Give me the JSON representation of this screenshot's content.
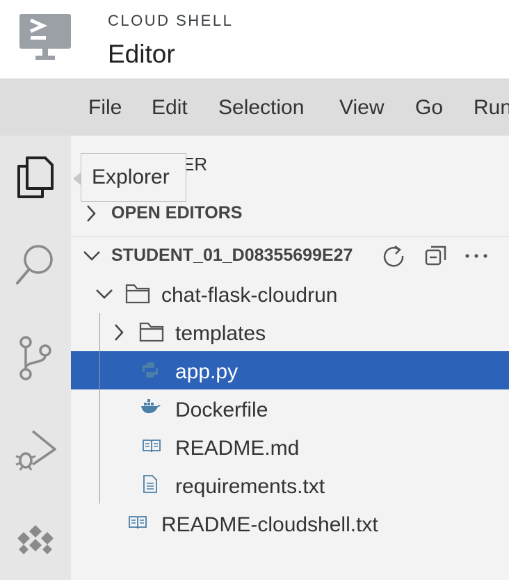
{
  "header": {
    "subtitle": "CLOUD SHELL",
    "title": "Editor",
    "logo_icon": "terminal-monitor-icon"
  },
  "menu": [
    "File",
    "Edit",
    "Selection",
    "View",
    "Go",
    "Run"
  ],
  "activity_bar": [
    {
      "name": "explorer",
      "icon": "files-icon"
    },
    {
      "name": "search",
      "icon": "search-icon"
    },
    {
      "name": "source-control",
      "icon": "git-branch-icon"
    },
    {
      "name": "run-debug",
      "icon": "run-debug-icon"
    },
    {
      "name": "cloud-code",
      "icon": "cloud-code-icon"
    }
  ],
  "tooltip": {
    "text": "Explorer"
  },
  "explorer": {
    "title_partial": "ER",
    "open_editors_label": "OPEN EDITORS",
    "workspace_label": "STUDENT_01_D08355699E27",
    "items": [
      {
        "label": "chat-flask-cloudrun",
        "type": "folder",
        "expanded": true
      },
      {
        "label": "templates",
        "type": "folder",
        "expanded": false
      },
      {
        "label": "app.py",
        "type": "python",
        "selected": true
      },
      {
        "label": "Dockerfile",
        "type": "docker"
      },
      {
        "label": "README.md",
        "type": "markdown"
      },
      {
        "label": "requirements.txt",
        "type": "text"
      },
      {
        "label": "README-cloudshell.txt",
        "type": "markdown"
      }
    ]
  },
  "colors": {
    "selection": "#2c62b8",
    "accent_icon": "#4a7fa7"
  }
}
